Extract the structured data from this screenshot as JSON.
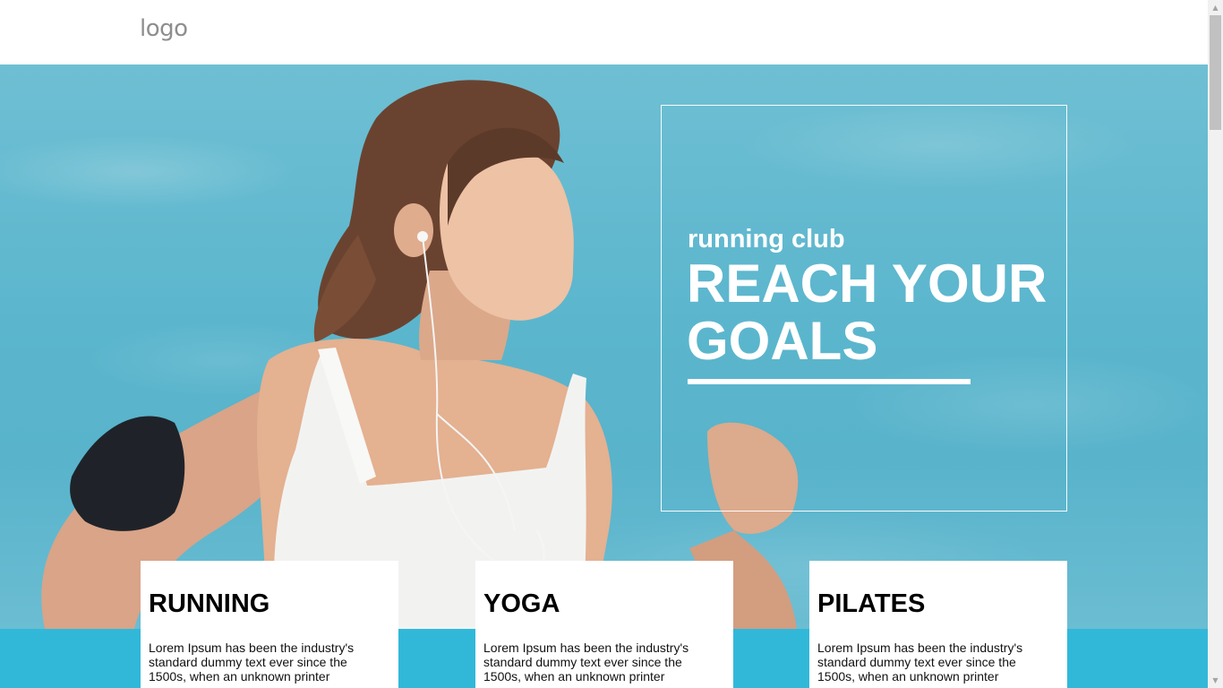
{
  "header": {
    "logo_text": "logo"
  },
  "hero": {
    "subtitle": "running club",
    "title": "REACH YOUR GOALS",
    "photo": "woman-running-with-earphones"
  },
  "cards": [
    {
      "title": "RUNNING",
      "text": "Lorem Ipsum has been the industry's standard dummy text ever since the 1500s, when an unknown printer"
    },
    {
      "title": "YOGA",
      "text": "Lorem Ipsum has been the industry's standard dummy text ever since the 1500s, when an unknown printer"
    },
    {
      "title": "PILATES",
      "text": "Lorem Ipsum has been the industry's standard dummy text ever since the 1500s, when an unknown printer"
    }
  ],
  "colors": {
    "accent_band": "#31b8d9",
    "hero_sky": "#5bb6cd",
    "logo": "#8e8e8e"
  },
  "scrollbar": {
    "up_icon": "triangle-up-icon",
    "down_icon": "triangle-down-icon"
  }
}
